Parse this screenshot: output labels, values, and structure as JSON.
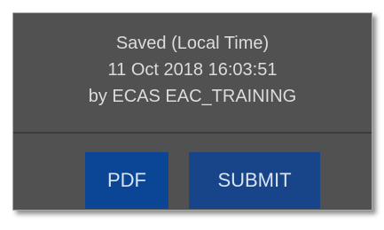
{
  "save_panel": {
    "status_line_1": "Saved (Local Time)",
    "status_line_2": "11 Oct 2018 16:03:51",
    "status_line_3": "by ECAS EAC_TRAINING"
  },
  "actions": {
    "pdf_label": "PDF",
    "submit_label": "SUBMIT"
  },
  "colors": {
    "panel_bg": "#515151",
    "text": "#dcdcdc",
    "pdf_button": "#0b4595",
    "submit_button": "#18448a"
  }
}
